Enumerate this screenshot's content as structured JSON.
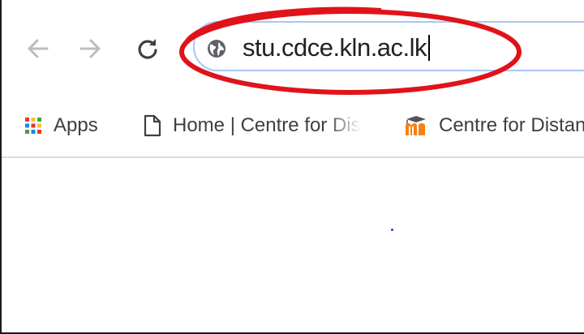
{
  "toolbar": {
    "back_icon": "arrow-left-icon",
    "forward_icon": "arrow-right-icon",
    "reload_icon": "reload-icon",
    "site_info_icon": "globe-icon",
    "url": "stu.cdce.kln.ac.lk",
    "omnibox_border_color": "#a8c7f5"
  },
  "annotation": {
    "shape": "oval",
    "color": "#e0131a"
  },
  "bookmarks": [
    {
      "label": "Apps",
      "icon": "apps-grid-icon"
    },
    {
      "label": "Home | Centre for Dis",
      "icon": "page-icon"
    },
    {
      "label": "Centre for Distan",
      "icon": "moodle-icon"
    }
  ],
  "page": {
    "loading_indicator_color": "#2b3cd1"
  }
}
